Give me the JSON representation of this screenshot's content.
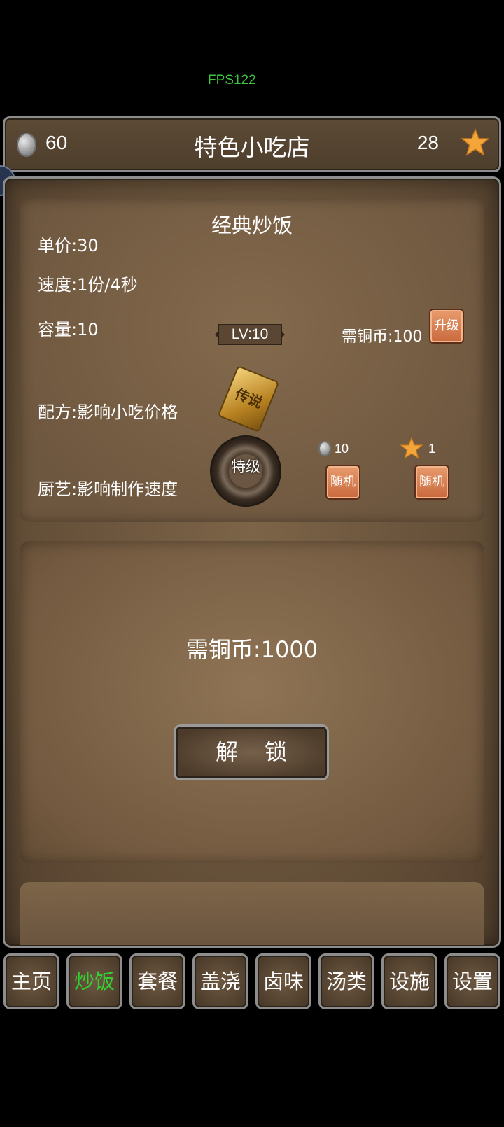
{
  "fps": "FPS122",
  "header": {
    "coins": "60",
    "title": "特色小吃店",
    "stars": "28"
  },
  "dish": {
    "name": "经典炒饭",
    "price": "单价:30",
    "speed": "速度:1份/4秒",
    "capacity": "容量:10",
    "level": "LV:10",
    "upgrade_cost": "需铜币:100",
    "upgrade_label": "升级",
    "recipe_label": "配方:影响小吃价格",
    "recipe_item": "传说",
    "skill_label": "厨艺:影响制作速度",
    "skill_grade": "特级",
    "random_coin_cost": "10",
    "random_star_cost": "1",
    "random_label": "随机"
  },
  "locked": {
    "cost": "需铜币:1000",
    "unlock_label": "解锁"
  },
  "nav": {
    "tabs": [
      "主页",
      "炒饭",
      "套餐",
      "盖浇",
      "卤味",
      "汤类",
      "设施",
      "设置"
    ],
    "active": "炒饭"
  },
  "colors": {
    "active_tab": "#32d232",
    "fps": "#3ec63e",
    "button_orange": "#d9794a"
  }
}
